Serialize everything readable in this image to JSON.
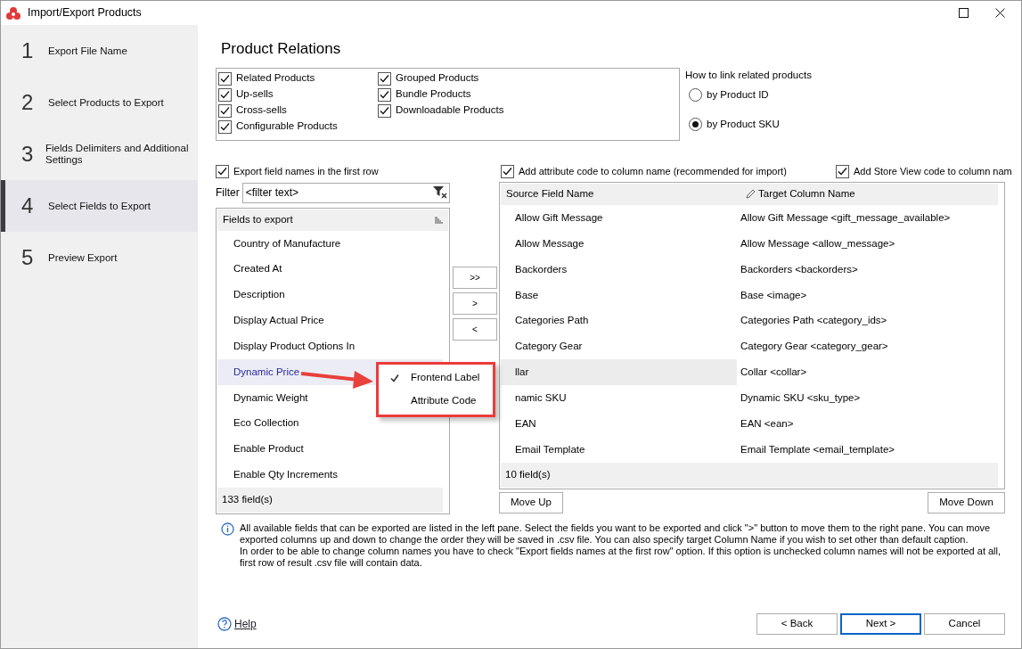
{
  "window": {
    "title": "Import/Export Products"
  },
  "steps": [
    {
      "number": "1",
      "label": "Export File Name",
      "selected": false
    },
    {
      "number": "2",
      "label": "Select Products to Export",
      "selected": false
    },
    {
      "number": "3",
      "label": "Fields Delimiters and Additional Settings",
      "selected": false
    },
    {
      "number": "4",
      "label": "Select Fields to Export",
      "selected": true
    },
    {
      "number": "5",
      "label": "Preview Export",
      "selected": false
    }
  ],
  "heading": "Product Relations",
  "relations": {
    "columns": [
      [
        {
          "label": "Related Products",
          "checked": true
        },
        {
          "label": "Up-sells",
          "checked": true
        },
        {
          "label": "Cross-sells",
          "checked": true
        },
        {
          "label": "Configurable Products",
          "checked": true
        }
      ],
      [
        {
          "label": "Grouped Products",
          "checked": true
        },
        {
          "label": "Bundle Products",
          "checked": true
        },
        {
          "label": "Downloadable Products",
          "checked": true
        }
      ]
    ]
  },
  "link_options": {
    "title": "How to link related products",
    "options": [
      {
        "label": "by Product ID",
        "selected": false
      },
      {
        "label": "by Product SKU",
        "selected": true
      }
    ]
  },
  "export_field_names": {
    "label": "Export field names in the first row",
    "checked": true
  },
  "add_attribute_code": {
    "label": "Add attribute code to column name (recommended for import)",
    "checked": true
  },
  "add_store_view_code": {
    "label": "Add Store View code to column nam",
    "checked": true
  },
  "filter": {
    "label": "Filter",
    "value": "<filter text>"
  },
  "fields_list": {
    "header": "Fields to export",
    "footer": "133 field(s)",
    "items": [
      {
        "label": "Country of Manufacture",
        "selected": false
      },
      {
        "label": "Created At",
        "selected": false
      },
      {
        "label": "Description",
        "selected": false
      },
      {
        "label": "Display Actual Price",
        "selected": false
      },
      {
        "label": "Display Product Options In",
        "selected": false
      },
      {
        "label": "Dynamic Price",
        "selected": true
      },
      {
        "label": "Dynamic Weight",
        "selected": false
      },
      {
        "label": "Eco Collection",
        "selected": false
      },
      {
        "label": "Enable Product",
        "selected": false
      },
      {
        "label": "Enable Qty Increments",
        "selected": false
      }
    ]
  },
  "transfer_buttons": [
    ">>",
    ">",
    "<"
  ],
  "grid": {
    "columns": [
      "Source Field Name",
      "Target Column Name"
    ],
    "footer": "10 field(s)",
    "rows": [
      {
        "source": "Allow Gift Message",
        "target": "Allow Gift Message <gift_message_available>",
        "selected": false
      },
      {
        "source": "Allow Message",
        "target": "Allow Message <allow_message>",
        "selected": false
      },
      {
        "source": "Backorders",
        "target": "Backorders <backorders>",
        "selected": false
      },
      {
        "source": "Base",
        "target": "Base <image>",
        "selected": false
      },
      {
        "source": "Categories Path",
        "target": "Categories Path <category_ids>",
        "selected": false
      },
      {
        "source": "Category Gear",
        "target": "Category Gear <category_gear>",
        "selected": false
      },
      {
        "source": "llar",
        "target": "Collar <collar>",
        "selected": true
      },
      {
        "source": "namic SKU",
        "target": "Dynamic SKU <sku_type>",
        "selected": false
      },
      {
        "source": "EAN",
        "target": "EAN <ean>",
        "selected": false
      },
      {
        "source": "Email Template",
        "target": "Email Template <email_template>",
        "selected": false
      }
    ]
  },
  "move_up": "Move Up",
  "move_down": "Move Down",
  "context_menu": {
    "items": [
      {
        "label": "Frontend Label",
        "checked": true
      },
      {
        "label": "Attribute Code",
        "checked": false
      }
    ]
  },
  "info": [
    "All available fields that can be exported are listed in the left pane. Select the fields you want to be exported and click \">\" button to move them to the right pane. You can move exported columns up and down to change the order they will be saved in .csv file. You can also specify target Column Name if you wish to set other than default caption.",
    "In order to be able to change column names you have to check \"Export fields names at the first row\" option. If this option is unchecked column names will not be exported at all, first row of result .csv file will contain data."
  ],
  "help": "Help",
  "buttons": [
    {
      "label": "< Back",
      "default": false
    },
    {
      "label": "Next >",
      "default": true
    },
    {
      "label": "Cancel",
      "default": false
    }
  ]
}
